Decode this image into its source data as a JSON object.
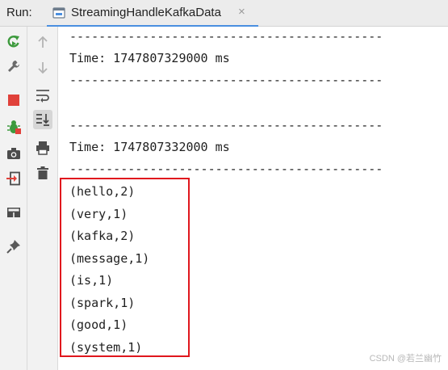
{
  "header": {
    "run_label": "Run:",
    "tab": {
      "title": "StreamingHandleKafkaData",
      "close": "×"
    }
  },
  "toolbar_left": [
    "rerun-icon",
    "settings-wrench-icon",
    "stop-icon",
    "debug-bug-icon",
    "camera-icon",
    "exit-icon",
    "layout-icon",
    "pin-icon"
  ],
  "toolbar_right": [
    "scroll-up-arrow-icon",
    "scroll-down-arrow-icon",
    "soft-wrap-icon",
    "scroll-to-end-icon",
    "print-icon",
    "trash-icon"
  ],
  "console": {
    "lines": [
      "-------------------------------------------",
      "Time: 1747807329000 ms",
      "-------------------------------------------",
      "",
      "-------------------------------------------",
      "Time: 1747807332000 ms",
      "-------------------------------------------",
      "(hello,2)",
      "(very,1)",
      "(kafka,2)",
      "(message,1)",
      "(is,1)",
      "(spark,1)",
      "(good,1)",
      "(system,1)"
    ]
  },
  "watermark": "CSDN @若兰幽竹",
  "colors": {
    "accent": "#4a8fe0",
    "highlight": "#e0161d",
    "stop": "#e0413a",
    "run_green": "#3d9a3d"
  }
}
